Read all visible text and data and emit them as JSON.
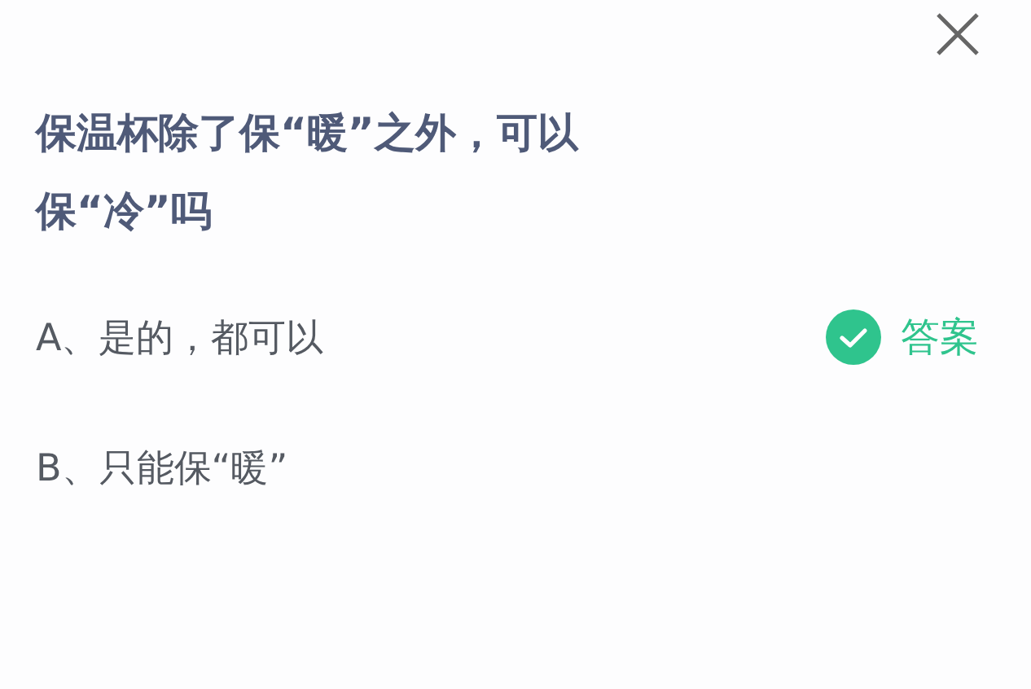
{
  "question": "保温杯除了保“暖”之外，可以保“冷”吗",
  "options": [
    {
      "text": "A、是的，都可以",
      "answer_label": "答案"
    },
    {
      "text": "B、只能保“暖”"
    }
  ]
}
